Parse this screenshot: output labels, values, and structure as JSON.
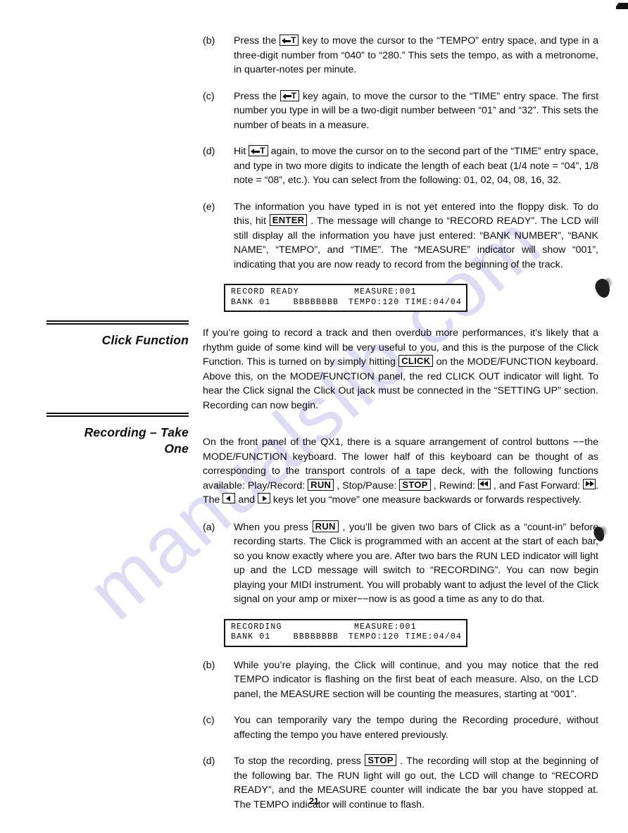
{
  "document": {
    "page_number": "21",
    "watermark": "manualslib.com"
  },
  "sections": [
    {
      "heading": null,
      "items": [
        {
          "label": "(b)",
          "parts": [
            {
              "t": "text",
              "v": "Press the "
            },
            {
              "t": "key-arrowT",
              "v": "T"
            },
            {
              "t": "text",
              "v": " key to move the cursor to the “TEMPO” entry space, and type in a three-digit number from “040” to “280.” This sets the tempo, as with a metronome, in quarter-notes per minute."
            }
          ]
        },
        {
          "label": "(c)",
          "parts": [
            {
              "t": "text",
              "v": "Press the "
            },
            {
              "t": "key-arrowT",
              "v": "T"
            },
            {
              "t": "text",
              "v": " key again, to move the cursor to the “TIME” entry space. The first number you type in will be a two-digit number between “01” and “32”. This sets the number of beats in a measure."
            }
          ]
        },
        {
          "label": "(d)",
          "parts": [
            {
              "t": "text",
              "v": "Hit "
            },
            {
              "t": "key-arrowT",
              "v": "T"
            },
            {
              "t": "text",
              "v": " again, to move the cursor on to the second part of the “TIME” entry space, and type in two more digits to indicate the length of each beat (1/4 note = “04”, 1/8 note = “08”, etc.). You can select from the following: 01, 02, 04, 08, 16, 32."
            }
          ]
        },
        {
          "label": "(e)",
          "parts": [
            {
              "t": "text",
              "v": "The information you have typed in is not yet entered into the floppy disk. To do this, hit "
            },
            {
              "t": "key",
              "v": "ENTER"
            },
            {
              "t": "text",
              "v": " . The message will change to “RECORD READY”. The LCD will still display all the information you have just entered: “BANK NUMBER”, “BANK NAME”, “TEMPO”, and “TIME”. The “MEASURE” indicator will show “001”, indicating that you are now ready to record from the beginning of the track."
            }
          ]
        }
      ]
    }
  ],
  "lcd_displays": [
    {
      "name": "record-ready-display",
      "line1_left": "RECORD READY",
      "line1_right": "MEASURE:001",
      "line2_left": "BANK 01    BBBBBBBB",
      "line2_right": "TEMPO:120 TIME:04/04"
    },
    {
      "name": "recording-display",
      "line1_left": "RECORDING",
      "line1_right": "MEASURE:001",
      "line2_left": "BANK 01    BBBBBBBB",
      "line2_right": "TEMPO:120 TIME:04/04"
    }
  ],
  "click_function": {
    "heading": "Click Function",
    "parts": [
      {
        "t": "text",
        "v": "If you’re going to record a track and then overdub more performances, it’s likely that a rhythm guide of some kind will be very useful to you, and this is the purpose of the Click Function. This is turned on by simply hitting "
      },
      {
        "t": "key",
        "v": "CLICK"
      },
      {
        "t": "text",
        "v": " on the MODE/FUNCTION keyboard. Above this, on the MODE/FUNCTION panel, the red CLICK OUT indicator will light. To hear the Click signal the Click Out jack must be connected in the “SETTING UP” section.  Recording can now begin."
      }
    ]
  },
  "recording_take_one": {
    "heading_line1": "Recording – Take",
    "heading_line2": "One",
    "intro_parts": [
      {
        "t": "text",
        "v": "On the front panel of the QX1, there is a square arrangement of control buttons −−the MODE/FUNCTION keyboard.  The lower half of this keyboard can be thought of as corresponding to the transport controls of a tape deck, with the following functions available: Play/Record: "
      },
      {
        "t": "key",
        "v": "RUN"
      },
      {
        "t": "text",
        "v": " , Stop/Pause: "
      },
      {
        "t": "key",
        "v": "STOP"
      },
      {
        "t": "text",
        "v": " , Rewind: "
      },
      {
        "t": "key-rewind",
        "v": "◄◄"
      },
      {
        "t": "text",
        "v": " , and Fast Forward: "
      },
      {
        "t": "key-ffwd",
        "v": "►►"
      },
      {
        "t": "text",
        "v": ". The "
      },
      {
        "t": "key-left",
        "v": "◄"
      },
      {
        "t": "text",
        "v": " and "
      },
      {
        "t": "key-right",
        "v": "►"
      },
      {
        "t": "text",
        "v": " keys let you “move” one measure backwards or forwards respectively."
      }
    ],
    "items": [
      {
        "label": "(a)",
        "parts": [
          {
            "t": "text",
            "v": "When you press "
          },
          {
            "t": "key",
            "v": "RUN"
          },
          {
            "t": "text",
            "v": " , you’ll be given two bars of Click as a “count-in” before recording starts.  The Click is programmed with an accent at the start of each bar, so you know exactly where you are. After two bars the RUN LED indicator will light up and the LCD message will switch to “RECORDING”. You can now begin playing your MIDI instrument. You will probably want to adjust the level of the Click signal on your amp or mixer−−now is as good a time as any to do that."
          }
        ]
      },
      {
        "label": "(b)",
        "parts": [
          {
            "t": "text",
            "v": "While you’re playing, the Click will continue, and you may notice that the red TEMPO indicator is flashing on the first beat of each measure. Also, on the LCD panel, the MEASURE section will be counting the measures, starting at “001”."
          }
        ]
      },
      {
        "label": "(c)",
        "parts": [
          {
            "t": "text",
            "v": "You can temporarily vary the tempo during the Recording procedure, without affecting the tempo you have entered previously."
          }
        ]
      },
      {
        "label": "(d)",
        "parts": [
          {
            "t": "text",
            "v": "To stop the recording, press "
          },
          {
            "t": "key",
            "v": "STOP"
          },
          {
            "t": "text",
            "v": " . The recording will stop at the beginning of the following bar. The RUN light will go out, the LCD will change to “RECORD READY”, and the MEASURE counter will indicate the bar you have stopped at. The TEMPO indicator will continue to flash."
          }
        ]
      }
    ]
  }
}
